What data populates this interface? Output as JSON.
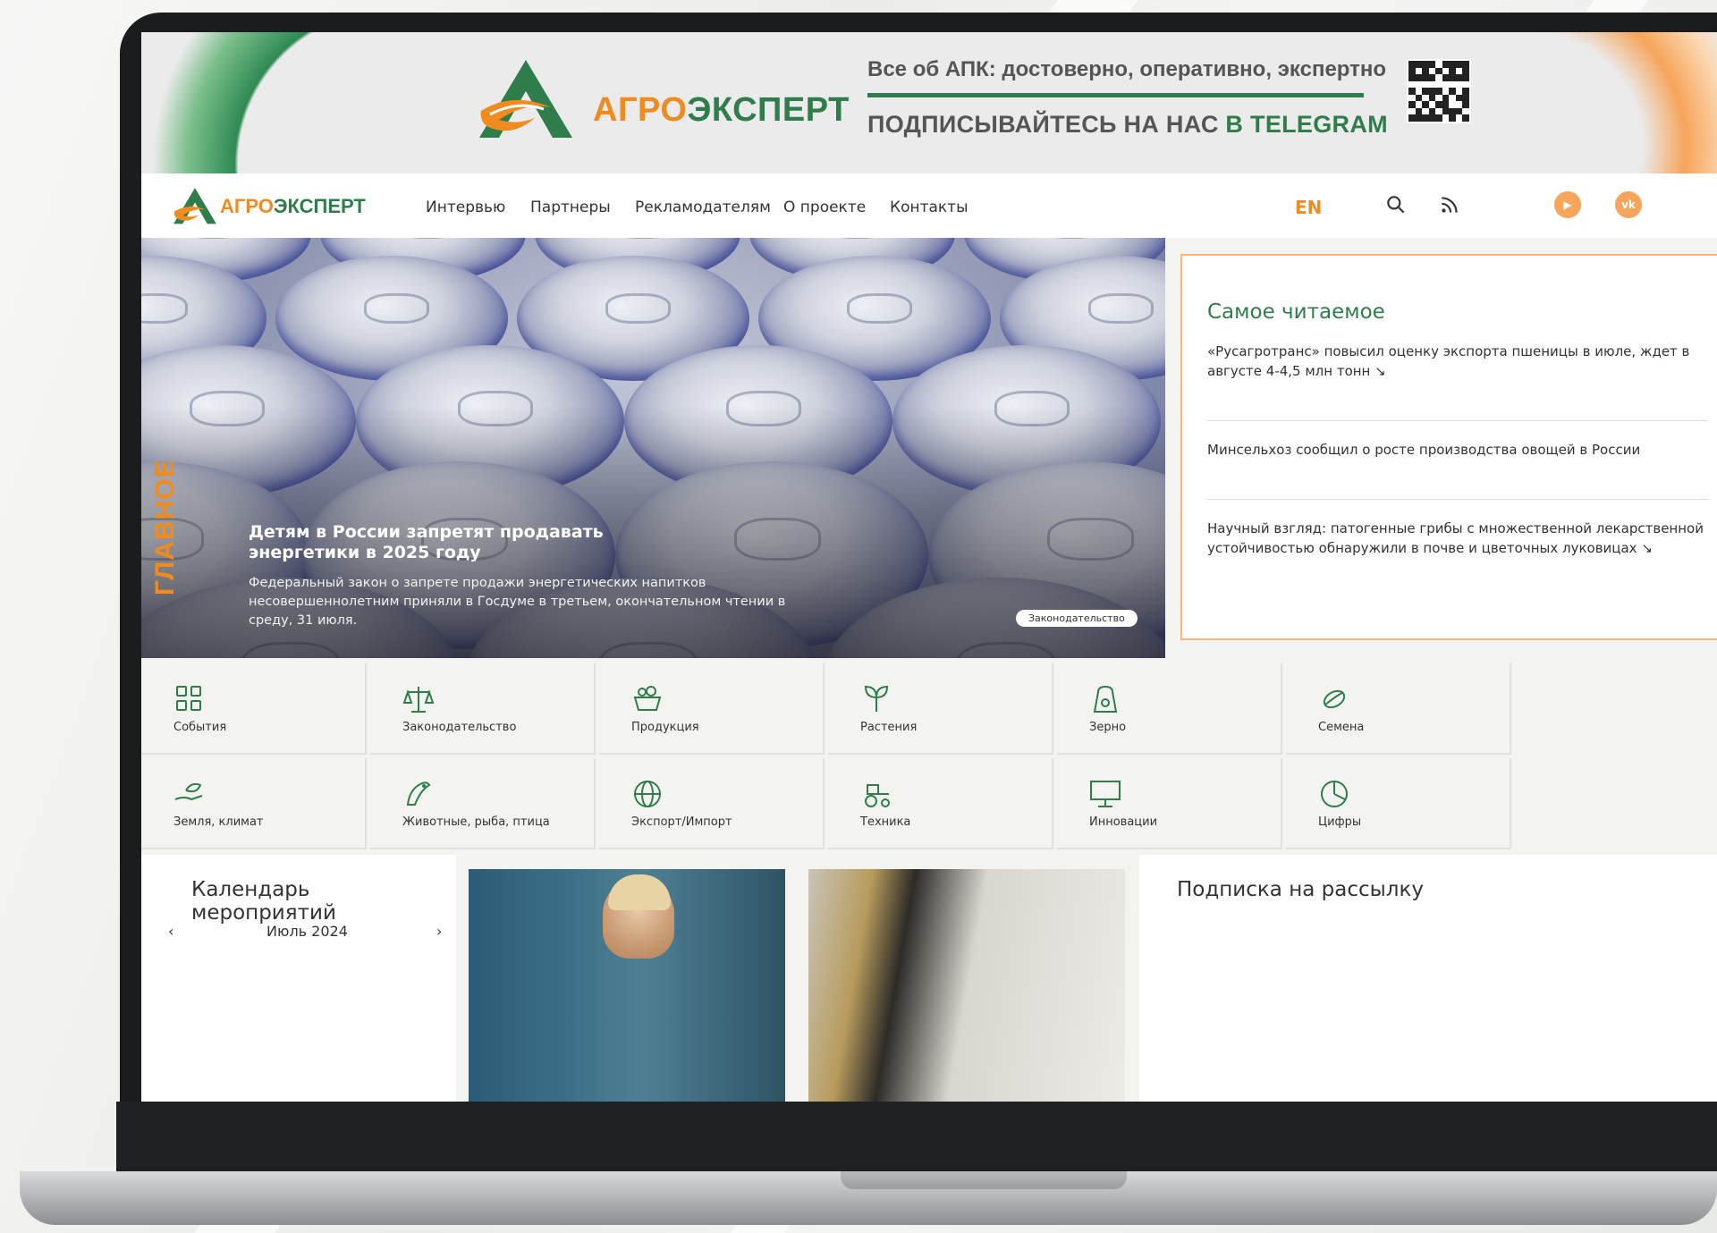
{
  "banner": {
    "brand_part1": "АГРО",
    "brand_part2": "ЭКСПЕРТ",
    "tagline": "Все об АПК: достоверно, оперативно, экспертно",
    "subscribe_part1": "ПОДПИСЫВАЙТЕСЬ НА НАС ",
    "subscribe_part2": "В TELEGRAM"
  },
  "nav": {
    "brand_part1": "АГРО",
    "brand_part2": "ЭКСПЕРТ",
    "items": [
      "Интервью",
      "Партнеры",
      "Рекламодателям",
      "О проекте",
      "Контакты"
    ],
    "lang": "EN",
    "social": [
      "▶",
      "vk"
    ]
  },
  "hero": {
    "section_label": "ГЛАВНОЕ",
    "title": "Детям в России запретят продавать энергетики в 2025 году",
    "text": "Федеральный закон о запрете продажи энергетических напитков несовершеннолетним приняли в Госдуме в третьем, окончательном чтении в среду, 31 июля.",
    "tag": "Законодательство"
  },
  "most_read": {
    "title": "Самое читаемое",
    "items": [
      "«Русагротранс» повысил оценку экспорта пшеницы в июле, ждет в августе 4-4,5 млн тонн ↘",
      "Минсельхоз сообщил о росте производства овощей в России",
      "Научный взгляд: патогенные грибы с множественной лекарственной устойчивостью обнаружили в почве и цветочных луковицах ↘"
    ]
  },
  "categories": [
    {
      "label": "События",
      "icon": "grid-icon"
    },
    {
      "label": "Законодательство",
      "icon": "scales-icon"
    },
    {
      "label": "Продукция",
      "icon": "basket-icon"
    },
    {
      "label": "Растения",
      "icon": "sprout-icon"
    },
    {
      "label": "Зерно",
      "icon": "grain-bag-icon"
    },
    {
      "label": "Семена",
      "icon": "seed-icon"
    },
    {
      "label": "Земля, климат",
      "icon": "hand-leaf-icon"
    },
    {
      "label": "Животные, рыба, птица",
      "icon": "fish-icon"
    },
    {
      "label": "Экспорт/Импорт",
      "icon": "globe-icon"
    },
    {
      "label": "Техника",
      "icon": "tractor-icon"
    },
    {
      "label": "Инновации",
      "icon": "monitor-icon"
    },
    {
      "label": "Цифры",
      "icon": "pie-chart-icon"
    }
  ],
  "bottom": {
    "calendar_title": "Календарь мероприятий",
    "calendar_month": "Июль 2024",
    "newsletter_title": "Подписка на рассылку"
  },
  "colors": {
    "green": "#2e7d4a",
    "orange": "#f08c1f"
  }
}
